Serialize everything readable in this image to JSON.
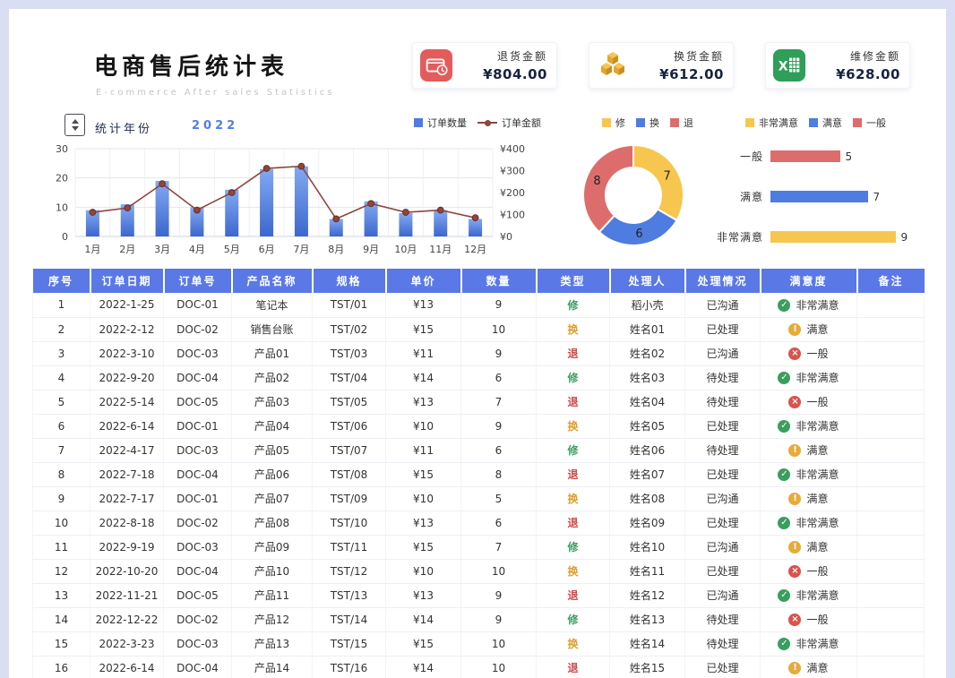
{
  "header": {
    "title": "电商售后统计表",
    "subtitle": "E-commerce After sales Statistics",
    "kpis": [
      {
        "label": "退货金额",
        "value": "¥804.00",
        "icon": "wallet-icon",
        "accent": "#e35c5c"
      },
      {
        "label": "换货金额",
        "value": "¥612.00",
        "icon": "cubes-icon",
        "accent": "#f6c453"
      },
      {
        "label": "维修金额",
        "value": "¥628.00",
        "icon": "spreadsheet-icon",
        "accent": "#2f9e58"
      }
    ]
  },
  "filter": {
    "label": "统计年份",
    "value": "2022"
  },
  "chart_data": [
    {
      "type": "bar",
      "subtype": "combo-bar-line",
      "categories": [
        "1月",
        "2月",
        "3月",
        "4月",
        "5月",
        "6月",
        "7月",
        "8月",
        "9月",
        "10月",
        "11月",
        "12月"
      ],
      "series": [
        {
          "name": "订单数量",
          "kind": "bar",
          "axis": "left",
          "values": [
            9,
            11,
            19,
            10,
            16,
            23,
            24,
            6,
            12,
            8,
            9,
            6
          ]
        },
        {
          "name": "订单金额",
          "kind": "line",
          "axis": "right",
          "values": [
            110,
            130,
            240,
            120,
            200,
            310,
            320,
            80,
            150,
            110,
            120,
            85
          ]
        }
      ],
      "left_axis": {
        "min": 0,
        "max": 30,
        "ticks": [
          0,
          10,
          20,
          30
        ]
      },
      "right_axis": {
        "min": 0,
        "max": 400,
        "ticks": [
          "¥0",
          "¥100",
          "¥200",
          "¥300",
          "¥400"
        ]
      },
      "colors": {
        "legend_bar": "#4e7ce0",
        "bar_top": "#83a9f3",
        "bar_bottom": "#3c67cd",
        "line": "#8f463c"
      },
      "grid": true,
      "legend_position": "top"
    },
    {
      "type": "pie",
      "subtype": "donut",
      "legend": [
        "修",
        "换",
        "退"
      ],
      "labels": [
        "修",
        "换",
        "退"
      ],
      "values": [
        7,
        6,
        8
      ],
      "colors": [
        "#f7c64f",
        "#4e7ce0",
        "#dd6d6d"
      ]
    },
    {
      "type": "bar",
      "subtype": "horizontal",
      "legend": [
        "非常满意",
        "满意",
        "一般"
      ],
      "legend_colors": [
        "#f7c64f",
        "#4e7ce0",
        "#dd6d6d"
      ],
      "categories": [
        "一般",
        "满意",
        "非常满意"
      ],
      "values": [
        5,
        7,
        9
      ],
      "colors": [
        "#dd6d6d",
        "#4e7ce0",
        "#f7c64f"
      ],
      "xlim": [
        0,
        10
      ]
    }
  ],
  "table": {
    "headers": [
      "序号",
      "订单日期",
      "订单号",
      "产品名称",
      "规格",
      "单价",
      "数量",
      "类型",
      "处理人",
      "处理情况",
      "满意度",
      "备注"
    ],
    "type_colors": {
      "修": "#3f9e63",
      "换": "#dc9f2e",
      "退": "#cf4b4b"
    },
    "satisfaction_icons": {
      "非常满意": {
        "glyph": "✓",
        "color": "#3a9e5f",
        "name": "check"
      },
      "满意": {
        "glyph": "!",
        "color": "#e6ab3a",
        "name": "exclaim"
      },
      "一般": {
        "glyph": "×",
        "color": "#d9534f",
        "name": "cross"
      }
    },
    "rows": [
      [
        "1",
        "2022-1-25",
        "DOC-01",
        "笔记本",
        "TST/01",
        "¥13",
        "9",
        "修",
        "稻小壳",
        "已沟通",
        "非常满意",
        ""
      ],
      [
        "2",
        "2022-2-12",
        "DOC-02",
        "销售台账",
        "TST/02",
        "¥15",
        "10",
        "换",
        "姓名01",
        "已处理",
        "满意",
        ""
      ],
      [
        "3",
        "2022-3-10",
        "DOC-03",
        "产品01",
        "TST/03",
        "¥11",
        "9",
        "退",
        "姓名02",
        "已沟通",
        "一般",
        ""
      ],
      [
        "4",
        "2022-9-20",
        "DOC-04",
        "产品02",
        "TST/04",
        "¥14",
        "6",
        "修",
        "姓名03",
        "待处理",
        "非常满意",
        ""
      ],
      [
        "5",
        "2022-5-14",
        "DOC-05",
        "产品03",
        "TST/05",
        "¥13",
        "7",
        "退",
        "姓名04",
        "待处理",
        "一般",
        ""
      ],
      [
        "6",
        "2022-6-14",
        "DOC-01",
        "产品04",
        "TST/06",
        "¥10",
        "9",
        "换",
        "姓名05",
        "已处理",
        "非常满意",
        ""
      ],
      [
        "7",
        "2022-4-17",
        "DOC-03",
        "产品05",
        "TST/07",
        "¥11",
        "6",
        "修",
        "姓名06",
        "待处理",
        "满意",
        ""
      ],
      [
        "8",
        "2022-7-18",
        "DOC-04",
        "产品06",
        "TST/08",
        "¥15",
        "8",
        "退",
        "姓名07",
        "已处理",
        "非常满意",
        ""
      ],
      [
        "9",
        "2022-7-17",
        "DOC-01",
        "产品07",
        "TST/09",
        "¥10",
        "5",
        "换",
        "姓名08",
        "已沟通",
        "满意",
        ""
      ],
      [
        "10",
        "2022-8-18",
        "DOC-02",
        "产品08",
        "TST/10",
        "¥13",
        "6",
        "退",
        "姓名09",
        "已处理",
        "非常满意",
        ""
      ],
      [
        "11",
        "2022-9-19",
        "DOC-03",
        "产品09",
        "TST/11",
        "¥15",
        "7",
        "修",
        "姓名10",
        "已沟通",
        "满意",
        ""
      ],
      [
        "12",
        "2022-10-20",
        "DOC-04",
        "产品10",
        "TST/12",
        "¥10",
        "10",
        "换",
        "姓名11",
        "已处理",
        "一般",
        ""
      ],
      [
        "13",
        "2022-11-21",
        "DOC-05",
        "产品11",
        "TST/13",
        "¥13",
        "9",
        "退",
        "姓名12",
        "已沟通",
        "非常满意",
        ""
      ],
      [
        "14",
        "2022-12-22",
        "DOC-02",
        "产品12",
        "TST/14",
        "¥14",
        "9",
        "修",
        "姓名13",
        "待处理",
        "一般",
        ""
      ],
      [
        "15",
        "2022-3-23",
        "DOC-03",
        "产品13",
        "TST/15",
        "¥15",
        "10",
        "换",
        "姓名14",
        "待处理",
        "非常满意",
        ""
      ],
      [
        "16",
        "2022-6-14",
        "DOC-04",
        "产品14",
        "TST/16",
        "¥14",
        "10",
        "退",
        "姓名15",
        "已处理",
        "满意",
        ""
      ]
    ]
  }
}
